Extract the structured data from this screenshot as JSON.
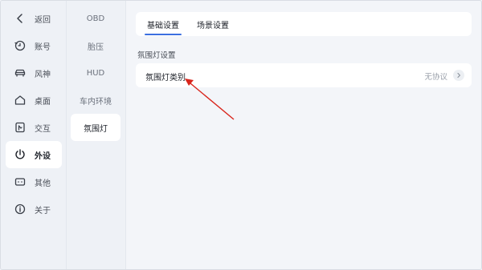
{
  "nav": {
    "items": [
      {
        "label": "返回",
        "icon": "chevron-left-icon"
      },
      {
        "label": "账号",
        "icon": "account-icon"
      },
      {
        "label": "风神",
        "icon": "car-icon"
      },
      {
        "label": "桌面",
        "icon": "home-icon"
      },
      {
        "label": "交互",
        "icon": "interaction-icon"
      },
      {
        "label": "外设",
        "icon": "peripheral-icon"
      },
      {
        "label": "其他",
        "icon": "more-icon"
      },
      {
        "label": "关于",
        "icon": "info-icon"
      }
    ],
    "active": "外设"
  },
  "subnav": {
    "items": [
      "OBD",
      "胎压",
      "HUD",
      "车内环境",
      "氛围灯"
    ],
    "active": "氛围灯"
  },
  "tabs": {
    "items": [
      "基础设置",
      "场景设置"
    ],
    "active": "基础设置"
  },
  "section": {
    "title": "氛围灯设置",
    "row": {
      "label": "氛围灯类别",
      "value": "无协议"
    }
  },
  "colors": {
    "accent": "#3c6fe0",
    "annotation_arrow": "#d9251c"
  }
}
